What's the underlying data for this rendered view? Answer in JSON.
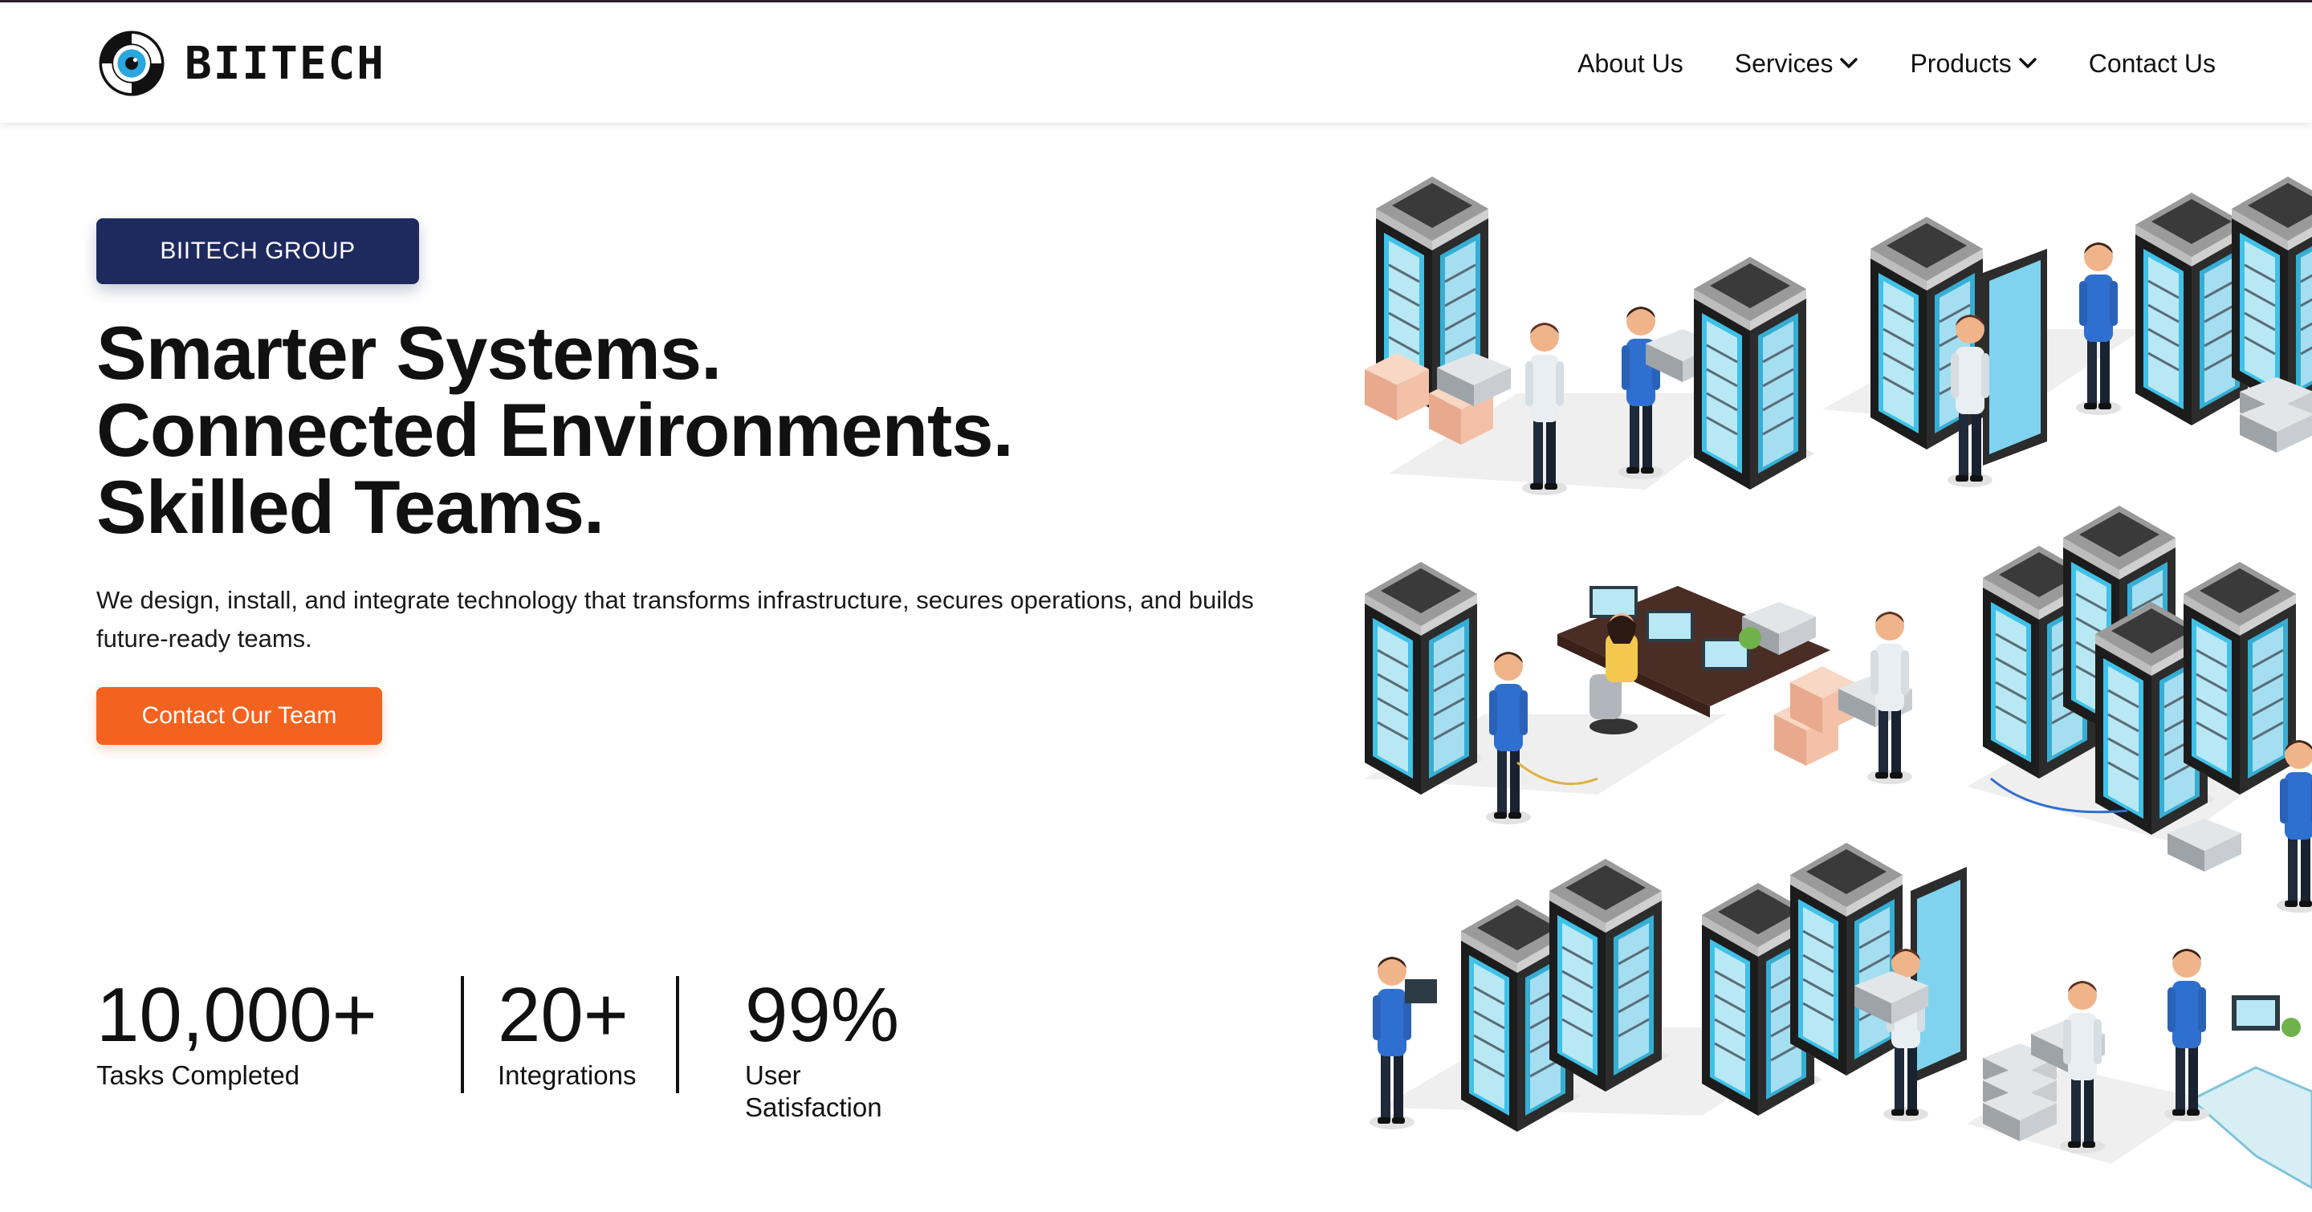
{
  "brand": {
    "name": "BIITECH",
    "logo_icon": "eye-swirl-logo"
  },
  "nav": {
    "items": [
      {
        "label": "About Us",
        "has_dropdown": false
      },
      {
        "label": "Services",
        "has_dropdown": true
      },
      {
        "label": "Products",
        "has_dropdown": true
      },
      {
        "label": "Contact Us",
        "has_dropdown": false
      }
    ]
  },
  "hero": {
    "badge": "BIITECH GROUP",
    "headline": [
      "Smarter Systems.",
      "Connected Environments.",
      "Skilled Teams."
    ],
    "lead": "We design, install, and integrate technology that transforms infrastructure, secures operations, and builds future-ready teams.",
    "cta_label": "Contact Our Team"
  },
  "stats": [
    {
      "value": "10,000+",
      "label": "Tasks Completed"
    },
    {
      "value": "20+",
      "label": "Integrations"
    },
    {
      "value": "99%",
      "label": "User Satisfaction"
    }
  ],
  "colors": {
    "badge_bg": "#1e2a5e",
    "cta_bg": "#f4621f",
    "logo_blue": "#2aa6e0",
    "server_dark": "#1c1c1c",
    "server_glass": "#3fc1e8",
    "worker_shirt_blue": "#2f6fd0"
  },
  "illustration": {
    "icon": "isometric-datacenter-illustration"
  }
}
